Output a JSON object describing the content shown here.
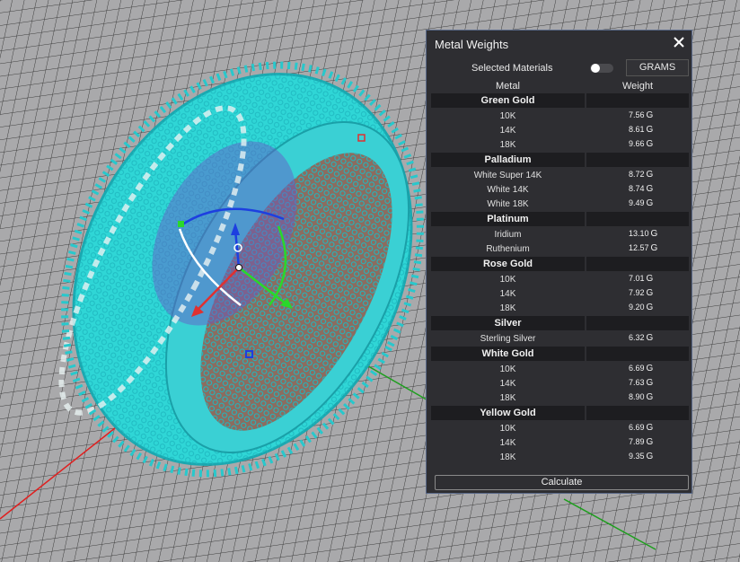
{
  "panel": {
    "title": "Metal Weights",
    "selected_materials_label": "Selected Materials",
    "unit_button_label": "GRAMS",
    "col_metal": "Metal",
    "col_weight": "Weight",
    "calculate_label": "Calculate",
    "unit_suffix": "G"
  },
  "groups": [
    {
      "name": "Green Gold",
      "items": [
        {
          "name": "10K",
          "value": "7.56"
        },
        {
          "name": "14K",
          "value": "8.61"
        },
        {
          "name": "18K",
          "value": "9.66"
        }
      ]
    },
    {
      "name": "Palladium",
      "items": [
        {
          "name": "White Super 14K",
          "value": "8.72"
        },
        {
          "name": "White 14K",
          "value": "8.74"
        },
        {
          "name": "White 18K",
          "value": "9.49"
        }
      ]
    },
    {
      "name": "Platinum",
      "items": [
        {
          "name": "Iridium",
          "value": "13.10"
        },
        {
          "name": "Ruthenium",
          "value": "12.57"
        }
      ]
    },
    {
      "name": "Rose Gold",
      "items": [
        {
          "name": "10K",
          "value": "7.01"
        },
        {
          "name": "14K",
          "value": "7.92"
        },
        {
          "name": "18K",
          "value": "9.20"
        }
      ]
    },
    {
      "name": "Silver",
      "items": [
        {
          "name": "Sterling Silver",
          "value": "6.32"
        }
      ]
    },
    {
      "name": "White Gold",
      "items": [
        {
          "name": "10K",
          "value": "6.69"
        },
        {
          "name": "14K",
          "value": "7.63"
        },
        {
          "name": "18K",
          "value": "8.90"
        }
      ]
    },
    {
      "name": "Yellow Gold",
      "items": [
        {
          "name": "10K",
          "value": "6.69"
        },
        {
          "name": "14K",
          "value": "7.89"
        },
        {
          "name": "18K",
          "value": "9.35"
        }
      ]
    }
  ],
  "colors": {
    "viewport_bg": "#a9a9ab",
    "grid_line": "#3a3a3a",
    "model_wire": "#2fd6d6",
    "axis_x": "#e02020",
    "axis_y": "#1e9e1e",
    "gizmo_blue": "#1d3fe0",
    "gizmo_green": "#2ad82a",
    "gizmo_red": "#e03030"
  }
}
